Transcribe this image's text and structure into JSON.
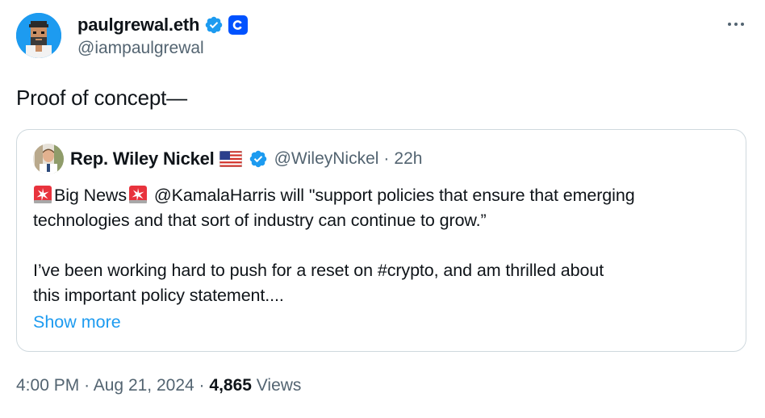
{
  "author": {
    "name": "paulgrewal.eth",
    "handle": "@iampaulgrewal",
    "verified_color": "#1d9bf0",
    "affiliate_color": "#0052ff",
    "affiliate_icon": "coinbase-logo-icon"
  },
  "tweet": {
    "text": "Proof of concept—"
  },
  "quote": {
    "name": "Rep. Wiley Nickel",
    "flag_icon": "us-flag-icon",
    "handle": "@WileyNickel",
    "separator": "·",
    "time": "22h",
    "line1_a": "Big News",
    "line1_b": " @KamalaHarris will \"support policies that ensure that emerging",
    "line2": "technologies and that sort of industry can continue to grow.”",
    "line3": "I’ve been working hard to push for a reset on #crypto, and am thrilled about",
    "line4": "this important policy statement....",
    "show_more": "Show more",
    "siren_icon": "rotating-light-icon"
  },
  "meta": {
    "time": "4:00 PM",
    "sep1": "·",
    "date": "Aug 21, 2024",
    "sep2": "·",
    "views_count": "4,865",
    "views_label": "Views"
  },
  "colors": {
    "link": "#1d9bf0",
    "secondary_text": "#536471",
    "primary_text": "#0f1419",
    "border": "#cfd9de"
  }
}
